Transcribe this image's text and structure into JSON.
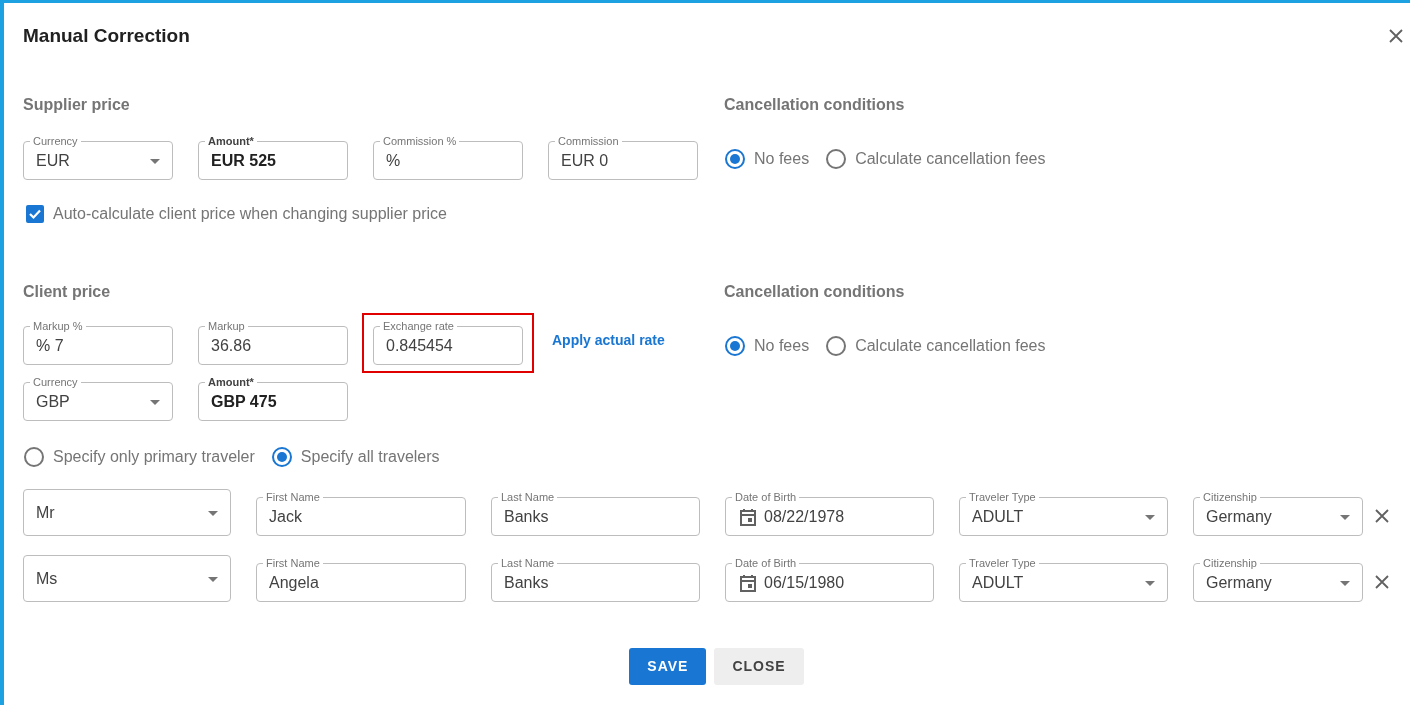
{
  "dialog": {
    "title": "Manual Correction"
  },
  "supplier_price": {
    "heading": "Supplier price",
    "fields": [
      {
        "kind": "select",
        "label": "Currency",
        "value": "EUR",
        "bold": false
      },
      {
        "kind": "text",
        "label": "Amount*",
        "value": "EUR 525",
        "bold": true
      },
      {
        "kind": "text",
        "label": "Commission %",
        "value": "%",
        "bold": false
      },
      {
        "kind": "text",
        "label": "Commission",
        "value": "EUR 0",
        "bold": false
      }
    ],
    "auto_calculate": {
      "label": "Auto-calculate client price when changing supplier price",
      "checked": true
    }
  },
  "supplier_cancellation": {
    "heading": "Cancellation conditions",
    "options": [
      {
        "label": "No fees",
        "selected": true
      },
      {
        "label": "Calculate cancellation fees",
        "selected": false
      }
    ]
  },
  "client_price": {
    "heading": "Client price",
    "fields": [
      {
        "kind": "text",
        "label": "Markup %",
        "value": "% 7",
        "bold": false,
        "highlighted": false
      },
      {
        "kind": "text",
        "label": "Markup",
        "value": "36.86",
        "bold": false,
        "highlighted": false
      },
      {
        "kind": "text",
        "label": "Exchange rate",
        "value": "0.845454",
        "bold": false,
        "highlighted": true
      }
    ],
    "apply_link": "Apply actual rate",
    "fields_2": [
      {
        "kind": "select",
        "label": "Currency",
        "value": "GBP",
        "bold": false
      },
      {
        "kind": "text",
        "label": "Amount*",
        "value": "GBP 475",
        "bold": true
      }
    ]
  },
  "client_cancellation": {
    "heading": "Cancellation conditions",
    "options": [
      {
        "label": "No fees",
        "selected": true
      },
      {
        "label": "Calculate cancellation fees",
        "selected": false
      }
    ]
  },
  "traveler_mode": [
    {
      "label": "Specify only primary traveler",
      "selected": false
    },
    {
      "label": "Specify all travelers",
      "selected": true
    }
  ],
  "travelers": [
    {
      "fields": [
        {
          "kind": "select",
          "value": "Mr"
        },
        {
          "kind": "text",
          "label": "First Name",
          "value": "Jack"
        },
        {
          "kind": "text",
          "label": "Last Name",
          "value": "Banks"
        },
        {
          "kind": "date",
          "label": "Date of Birth",
          "value": "08/22/1978"
        },
        {
          "kind": "select",
          "label": "Traveler Type",
          "value": "ADULT"
        },
        {
          "kind": "select",
          "label": "Citizenship",
          "value": "Germany"
        }
      ]
    },
    {
      "fields": [
        {
          "kind": "select",
          "value": "Ms"
        },
        {
          "kind": "text",
          "label": "First Name",
          "value": "Angela"
        },
        {
          "kind": "text",
          "label": "Last Name",
          "value": "Banks"
        },
        {
          "kind": "date",
          "label": "Date of Birth",
          "value": "06/15/1980"
        },
        {
          "kind": "select",
          "label": "Traveler Type",
          "value": "ADULT"
        },
        {
          "kind": "select",
          "label": "Citizenship",
          "value": "Germany"
        }
      ]
    }
  ],
  "buttons": [
    {
      "label": "SAVE",
      "kind": "primary"
    },
    {
      "label": "CLOSE",
      "kind": "secondary"
    }
  ]
}
